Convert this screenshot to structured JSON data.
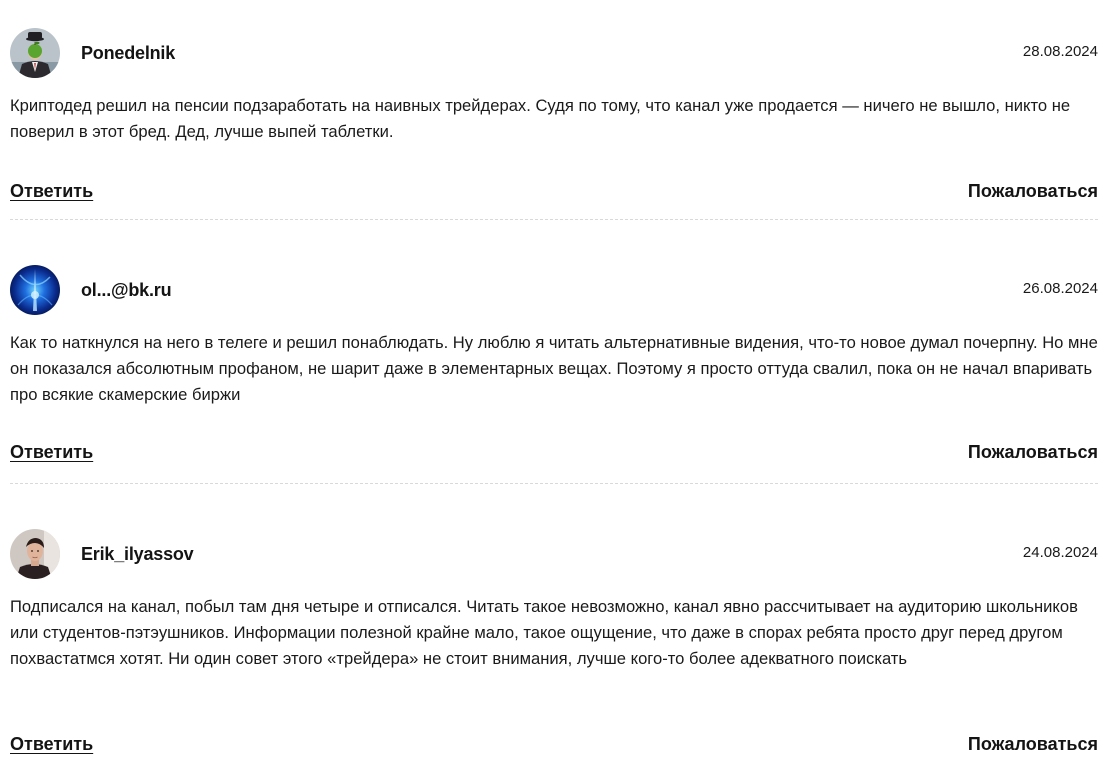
{
  "comments": [
    {
      "author": "Ponedelnik",
      "date": "28.08.2024",
      "avatar_icon": "man-with-green-apple-avatar",
      "text": "Криптодед решил на пенсии подзаработать на наивных трейдерах. Судя по тому, что канал уже продается — ничего не вышло, никто не поверил в этот бред. Дед, лучше выпей таблетки.",
      "reply_label": "Ответить",
      "report_label": "Пожаловаться"
    },
    {
      "author": "ol...@bk.ru",
      "date": "26.08.2024",
      "avatar_icon": "blue-light-abstract-avatar",
      "text": "Как то наткнулся на него в телеге и решил понаблюдать. Ну люблю я читать альтернативные видения, что-то новое думал почерпну. Но мне он показался абсолютным профаном, не шарит даже в элементарных вещах. Поэтому я просто оттуда свалил, пока он не начал впаривать про всякие скамерские биржи",
      "reply_label": "Ответить",
      "report_label": "Пожаловаться"
    },
    {
      "author": "Erik_ilyassov",
      "date": "24.08.2024",
      "avatar_icon": "young-man-photo-avatar",
      "text": "Подписался на канал, побыл там дня четыре и отписался. Читать такое невозможно, канал явно рассчитывает на аудиторию школьников или студентов-пэтэушников. Информации полезной крайне мало, такое ощущение, что даже в спорах ребята просто друг перед другом похвастатмся хотят. Ни один совет этого «трейдера» не стоит внимания, лучше кого-то более адекватного поискать",
      "reply_label": "Ответить",
      "report_label": "Пожаловаться"
    }
  ]
}
